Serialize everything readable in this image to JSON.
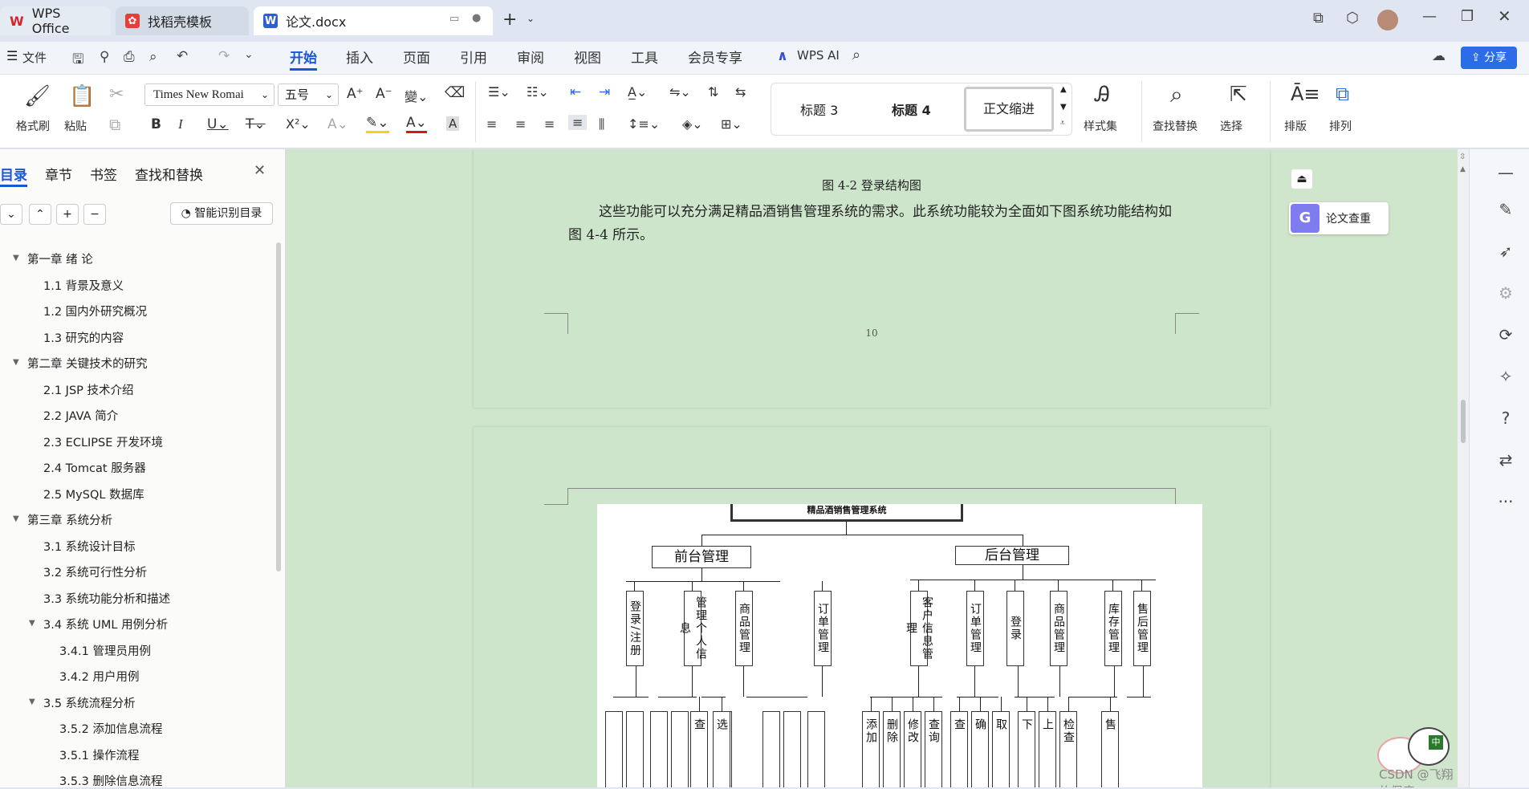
{
  "tabs": [
    {
      "label": "WPS Office"
    },
    {
      "label": "找稻壳模板"
    },
    {
      "label": "论文.docx"
    }
  ],
  "menu": {
    "file": "文件",
    "items": [
      "开始",
      "插入",
      "页面",
      "引用",
      "审阅",
      "视图",
      "工具",
      "会员专享"
    ],
    "wps_ai": "WPS AI",
    "share": "分享"
  },
  "ribbon": {
    "format_painter": "格式刷",
    "paste": "粘贴",
    "font_name": "Times New Romai",
    "font_size": "五号",
    "styles": [
      "标题 3",
      "标题 4",
      "正文缩进"
    ],
    "style_set": "样式集",
    "find_replace": "查找替换",
    "select": "选择",
    "layout": "排版",
    "arrange": "排列"
  },
  "sidebar": {
    "tabs": [
      "目录",
      "章节",
      "书签",
      "查找和替换"
    ],
    "smart_toc": "智能识别目录",
    "items": [
      {
        "label": "第一章 绪 论",
        "level": 1
      },
      {
        "label": "1.1 背景及意义",
        "level": 2
      },
      {
        "label": "1.2 国内外研究概况",
        "level": 2
      },
      {
        "label": "1.3  研究的内容",
        "level": 2
      },
      {
        "label": "第二章 关键技术的研究",
        "level": 1
      },
      {
        "label": "2.1 JSP 技术介绍",
        "level": 2
      },
      {
        "label": "2.2 JAVA 简介",
        "level": 2
      },
      {
        "label": "2.3 ECLIPSE  开发环境",
        "level": 2
      },
      {
        "label": "2.4 Tomcat 服务器",
        "level": 2
      },
      {
        "label": "2.5 MySQL 数据库",
        "level": 2
      },
      {
        "label": "第三章  系统分析",
        "level": 1
      },
      {
        "label": "3.1  系统设计目标",
        "level": 2
      },
      {
        "label": "3.2  系统可行性分析",
        "level": 2
      },
      {
        "label": "3.3  系统功能分析和描述",
        "level": 2
      },
      {
        "label": "3.4 系统 UML 用例分析",
        "level": 2
      },
      {
        "label": "3.4.1 管理员用例",
        "level": 3
      },
      {
        "label": "3.4.2 用户用例",
        "level": 3
      },
      {
        "label": "3.5 系统流程分析",
        "level": 2
      },
      {
        "label": "3.5.2 添加信息流程",
        "level": 3
      },
      {
        "label": "3.5.1 操作流程",
        "level": 3
      },
      {
        "label": "3.5.3 删除信息流程",
        "level": 3
      }
    ]
  },
  "document": {
    "figure_caption": "图 4-2  登录结构图",
    "paragraph": "这些功能可以充分满足精品酒销售管理系统的需求。此系统功能较为全面如下图系统功能结构如图 4-4 所示。",
    "page_number": "10",
    "org_root": "精品酒销售管理系统",
    "front": "前台管理",
    "back": "后台管理",
    "front_children": [
      "登录/注册",
      "管理个人信息",
      "商品管理",
      "订单管理"
    ],
    "back_children": [
      "客户信息管理",
      "订单管理",
      "登录",
      "商品管理",
      "库存管理",
      "售后管理"
    ],
    "leaves": [
      "添加",
      "删除",
      "修改",
      "查询",
      "查",
      "确",
      "取",
      "下",
      "上",
      "检查",
      "售",
      "查",
      "选"
    ]
  },
  "float": {
    "plagiarism": "论文查重"
  },
  "watermark": "CSDN @飞翔的佩奇"
}
